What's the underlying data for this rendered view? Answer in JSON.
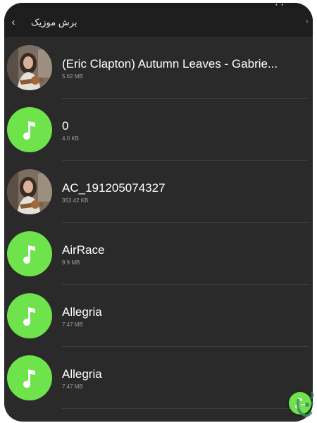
{
  "app": {
    "title": "برش موزیک",
    "back_icon": "chevron-left-icon",
    "menu_icon": "more-icon"
  },
  "colors": {
    "background": "#2a2a2a",
    "toolbar": "#1e1e1e",
    "accent": "#6fe34b",
    "title_text": "#ffffff",
    "meta_text": "#9d9d9d"
  },
  "songs": [
    {
      "title": "(Eric Clapton) Autumn Leaves - Gabrie...",
      "size": "5.62 MB",
      "thumb": "photo"
    },
    {
      "title": "0",
      "size": "4.0 KB",
      "thumb": "music-note-icon"
    },
    {
      "title": "AC_191205074327",
      "size": "353.42 KB",
      "thumb": "photo"
    },
    {
      "title": "AirRace",
      "size": "9.9 MB",
      "thumb": "music-note-icon"
    },
    {
      "title": "Allegria",
      "size": "7.47 MB",
      "thumb": "music-note-icon"
    },
    {
      "title": "Allegria",
      "size": "7.47 MB",
      "thumb": "music-note-icon"
    }
  ],
  "fab": {
    "icon": "music-edit-icon"
  }
}
